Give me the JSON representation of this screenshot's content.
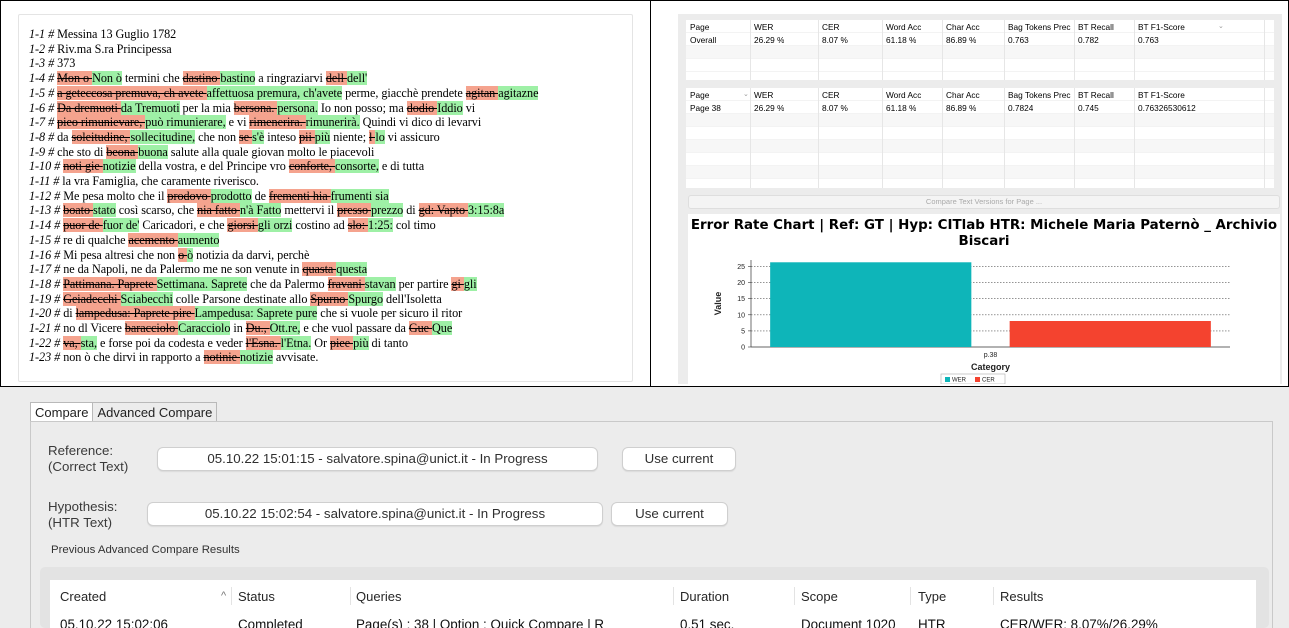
{
  "text_panel": {
    "lines": [
      [
        {
          "t": "1-1 # ",
          "k": "ln"
        },
        {
          "t": "Messina 13 Guglio 1782"
        }
      ],
      [
        {
          "t": "1-2 # ",
          "k": "ln"
        },
        {
          "t": "Riv.ma S.ra Principessa"
        }
      ],
      [
        {
          "t": "1-3 # ",
          "k": "ln"
        },
        {
          "t": "373"
        }
      ],
      [
        {
          "t": "1-4 # ",
          "k": "ln"
        },
        {
          "t": "Mon o ",
          "k": "del"
        },
        {
          "t": "Non ò",
          "k": "ins"
        },
        {
          "t": " termini che "
        },
        {
          "t": "dastino ",
          "k": "del"
        },
        {
          "t": "bastino",
          "k": "ins"
        },
        {
          "t": " a ringraziarvi "
        },
        {
          "t": "dell ",
          "k": "del"
        },
        {
          "t": "dell'",
          "k": "ins"
        }
      ],
      [
        {
          "t": "1-5 # ",
          "k": "ln"
        },
        {
          "t": "a geteccosa premuva, ch avete ",
          "k": "del"
        },
        {
          "t": "affettuosa premura, ch'avete",
          "k": "ins"
        },
        {
          "t": " perme, giacchè prendete "
        },
        {
          "t": "agitan ",
          "k": "del"
        },
        {
          "t": "agitazne",
          "k": "ins"
        }
      ],
      [
        {
          "t": "1-6 # ",
          "k": "ln"
        },
        {
          "t": "Da dremuoti ",
          "k": "del"
        },
        {
          "t": "da Tremuoti",
          "k": "ins"
        },
        {
          "t": " per la mia "
        },
        {
          "t": "bersona. ",
          "k": "del"
        },
        {
          "t": "persona.",
          "k": "ins"
        },
        {
          "t": " Io non posso; ma "
        },
        {
          "t": "dodio ",
          "k": "del"
        },
        {
          "t": "Iddio",
          "k": "ins"
        },
        {
          "t": " vi"
        }
      ],
      [
        {
          "t": "1-7 # ",
          "k": "ln"
        },
        {
          "t": "pieo rimunievare, ",
          "k": "del"
        },
        {
          "t": "può rimunierare,",
          "k": "ins"
        },
        {
          "t": " e vi "
        },
        {
          "t": "rimenerira. ",
          "k": "del"
        },
        {
          "t": "rimunerirà.",
          "k": "ins"
        },
        {
          "t": " Quindi vi dico di levarvi"
        }
      ],
      [
        {
          "t": "1-8 # ",
          "k": "ln"
        },
        {
          "t": "da "
        },
        {
          "t": "soleitudine, ",
          "k": "del"
        },
        {
          "t": "sollecitudine,",
          "k": "ins"
        },
        {
          "t": " che non "
        },
        {
          "t": "se ",
          "k": "del"
        },
        {
          "t": "s'è",
          "k": "ins"
        },
        {
          "t": " inteso "
        },
        {
          "t": "pii ",
          "k": "del"
        },
        {
          "t": "più",
          "k": "ins"
        },
        {
          "t": " niente; "
        },
        {
          "t": "l ",
          "k": "del"
        },
        {
          "t": "lo",
          "k": "ins"
        },
        {
          "t": " vi assicuro"
        }
      ],
      [
        {
          "t": "1-9 # ",
          "k": "ln"
        },
        {
          "t": "che sto di "
        },
        {
          "t": "beona ",
          "k": "del"
        },
        {
          "t": "buona",
          "k": "ins"
        },
        {
          "t": " salute alla quale giovan molto le piacevoli"
        }
      ],
      [
        {
          "t": "1-10 # ",
          "k": "ln"
        },
        {
          "t": "noti gie ",
          "k": "del"
        },
        {
          "t": "notizie",
          "k": "ins"
        },
        {
          "t": " della vostra, e del Principe vro "
        },
        {
          "t": "conforte, ",
          "k": "del"
        },
        {
          "t": "consorte,",
          "k": "ins"
        },
        {
          "t": " e di tutta"
        }
      ],
      [
        {
          "t": "1-11 # ",
          "k": "ln"
        },
        {
          "t": "la vra Famiglia, che caramente riverisco."
        }
      ],
      [
        {
          "t": "1-12 # ",
          "k": "ln"
        },
        {
          "t": "Me pesa molto che il "
        },
        {
          "t": "prodovo ",
          "k": "del"
        },
        {
          "t": "prodotto",
          "k": "ins"
        },
        {
          "t": " de "
        },
        {
          "t": "frementi hia ",
          "k": "del"
        },
        {
          "t": "frumenti sia",
          "k": "ins"
        }
      ],
      [
        {
          "t": "1-13 # ",
          "k": "ln"
        },
        {
          "t": "boato ",
          "k": "del"
        },
        {
          "t": "stato",
          "k": "ins"
        },
        {
          "t": " così scarso, che "
        },
        {
          "t": "nia fatto ",
          "k": "del"
        },
        {
          "t": "n'à Fatto",
          "k": "ins"
        },
        {
          "t": " mettervi il "
        },
        {
          "t": "presso ",
          "k": "del"
        },
        {
          "t": "prezzo",
          "k": "ins"
        },
        {
          "t": " di "
        },
        {
          "t": "gd: Vapto ",
          "k": "del"
        },
        {
          "t": "3:15:8a",
          "k": "ins"
        }
      ],
      [
        {
          "t": "1-14 # ",
          "k": "ln"
        },
        {
          "t": "puor de ",
          "k": "del"
        },
        {
          "t": "fuor de'",
          "k": "ins"
        },
        {
          "t": " Caricadori, e che "
        },
        {
          "t": "giorsi ",
          "k": "del"
        },
        {
          "t": "gli orzi",
          "k": "ins"
        },
        {
          "t": " costino ad "
        },
        {
          "t": "slo: ",
          "k": "del"
        },
        {
          "t": "1:25:",
          "k": "ins"
        },
        {
          "t": " col timo"
        }
      ],
      [
        {
          "t": "1-15 # ",
          "k": "ln"
        },
        {
          "t": "re di qualche "
        },
        {
          "t": "acemento ",
          "k": "del"
        },
        {
          "t": "aumento",
          "k": "ins"
        }
      ],
      [
        {
          "t": "1-16 # ",
          "k": "ln"
        },
        {
          "t": "Mi pesa altresi che non "
        },
        {
          "t": "o ",
          "k": "del"
        },
        {
          "t": "ò",
          "k": "ins"
        },
        {
          "t": " notizia da darvi, perchè"
        }
      ],
      [
        {
          "t": "1-17 # ",
          "k": "ln"
        },
        {
          "t": "ne da Napoli, ne da Palermo me ne son venute in "
        },
        {
          "t": "quasta ",
          "k": "del"
        },
        {
          "t": "questa",
          "k": "ins"
        }
      ],
      [
        {
          "t": "1-18 # ",
          "k": "ln"
        },
        {
          "t": "Pattimana. Paprete ",
          "k": "del"
        },
        {
          "t": "Settimana. Saprete",
          "k": "ins"
        },
        {
          "t": " che da Palermo "
        },
        {
          "t": "fravani ",
          "k": "del"
        },
        {
          "t": "stavan",
          "k": "ins"
        },
        {
          "t": " per partire "
        },
        {
          "t": "gi ",
          "k": "del"
        },
        {
          "t": "gli",
          "k": "ins"
        }
      ],
      [
        {
          "t": "1-19 # ",
          "k": "ln"
        },
        {
          "t": "Geiadecchi ",
          "k": "del"
        },
        {
          "t": "Sciabecchi",
          "k": "ins"
        },
        {
          "t": " colle Parsone destinate allo "
        },
        {
          "t": "Spurno ",
          "k": "del"
        },
        {
          "t": "Spurgo",
          "k": "ins"
        },
        {
          "t": " dell'Isoletta"
        }
      ],
      [
        {
          "t": "1-20 # ",
          "k": "ln"
        },
        {
          "t": "di "
        },
        {
          "t": "lampedusa: Paprete pire ",
          "k": "del"
        },
        {
          "t": "Lampedusa: Saprete pure",
          "k": "ins"
        },
        {
          "t": " che si vuole per sicuro il ritor"
        }
      ],
      [
        {
          "t": "1-21 # ",
          "k": "ln"
        },
        {
          "t": "no dl Vicere "
        },
        {
          "t": "baracciolo ",
          "k": "del"
        },
        {
          "t": "Caracciolo",
          "k": "ins"
        },
        {
          "t": " in "
        },
        {
          "t": "Du., ",
          "k": "del"
        },
        {
          "t": "Ott.re,",
          "k": "ins"
        },
        {
          "t": " e che vuol passare da "
        },
        {
          "t": "Gue ",
          "k": "del"
        },
        {
          "t": "Que",
          "k": "ins"
        }
      ],
      [
        {
          "t": "1-22 # ",
          "k": "ln"
        },
        {
          "t": "va, ",
          "k": "del"
        },
        {
          "t": "sta,",
          "k": "ins"
        },
        {
          "t": " e forse poi da codesta e veder "
        },
        {
          "t": "l'Esna. ",
          "k": "del"
        },
        {
          "t": "l'Etna.",
          "k": "ins"
        },
        {
          "t": " Or "
        },
        {
          "t": "piee ",
          "k": "del"
        },
        {
          "t": "più",
          "k": "ins"
        },
        {
          "t": " di tanto"
        }
      ],
      [
        {
          "t": "1-23 # ",
          "k": "ln"
        },
        {
          "t": "non ò che dirvi in rapporto a "
        },
        {
          "t": "notinie ",
          "k": "del"
        },
        {
          "t": "notizie",
          "k": "ins"
        },
        {
          "t": " avvisate."
        }
      ]
    ]
  },
  "overall_table": {
    "headers": [
      "Page",
      "WER",
      "CER",
      "Word Acc",
      "Char Acc",
      "Bag Tokens Prec",
      "BT Recall",
      "BT F1-Score"
    ],
    "rows": [
      [
        "Overall",
        "26.29 %",
        "8.07 %",
        "61.18 %",
        "86.89 %",
        "0.763",
        "0.782",
        "0.763"
      ]
    ]
  },
  "page_table": {
    "headers": [
      "Page",
      "WER",
      "CER",
      "Word Acc",
      "Char Acc",
      "Bag Tokens Prec",
      "BT Recall",
      "BT F1-Score"
    ],
    "rows": [
      [
        "Page 38",
        "26.29 %",
        "8.07 %",
        "61.18 %",
        "86.89 %",
        "0.7824",
        "0.745",
        "0.76326530612"
      ]
    ]
  },
  "compare_versions_button": "Compare Text Versions for Page ...",
  "chart_data": {
    "type": "bar",
    "title": "Error Rate Chart | Ref:  GT  | Hyp: CITlab HTR: Michele Maria Paternò _ Archivio Biscari",
    "categories": [
      "p.38"
    ],
    "series": [
      {
        "name": "WER",
        "values": [
          26.29
        ],
        "color": "#0eb5b9"
      },
      {
        "name": "CER",
        "values": [
          8.07
        ],
        "color": "#f4432f"
      }
    ],
    "xlabel": "Category",
    "ylabel": "Value",
    "ylim": [
      0,
      27
    ],
    "yticks": [
      0,
      5,
      10,
      15,
      20,
      25
    ],
    "grid": true,
    "legend": "bottom"
  },
  "tabs": [
    "Compare",
    "Advanced Compare"
  ],
  "reference": {
    "label_line1": "Reference:",
    "label_line2": "(Correct Text)",
    "value": "05.10.22 15:01:15 - salvatore.spina@unict.it - In Progress",
    "use_current": "Use current"
  },
  "hypothesis": {
    "label_line1": "Hypothesis:",
    "label_line2": "(HTR Text)",
    "value": "05.10.22 15:02:54 - salvatore.spina@unict.it - In Progress",
    "use_current": "Use current"
  },
  "previous_results": {
    "title": "Previous Advanced Compare Results",
    "columns": [
      "Created",
      "Status",
      "Queries",
      "Duration",
      "Scope",
      "Type",
      "Results"
    ],
    "sort_icon": "^",
    "rows": [
      [
        "05.10.22 15:02:06",
        "Completed",
        "Page(s) : 38 | Option : Quick Compare | R",
        "0.51 sec.",
        "Document 1020",
        "HTR",
        "CER/WER: 8.07%/26.29%"
      ]
    ]
  }
}
